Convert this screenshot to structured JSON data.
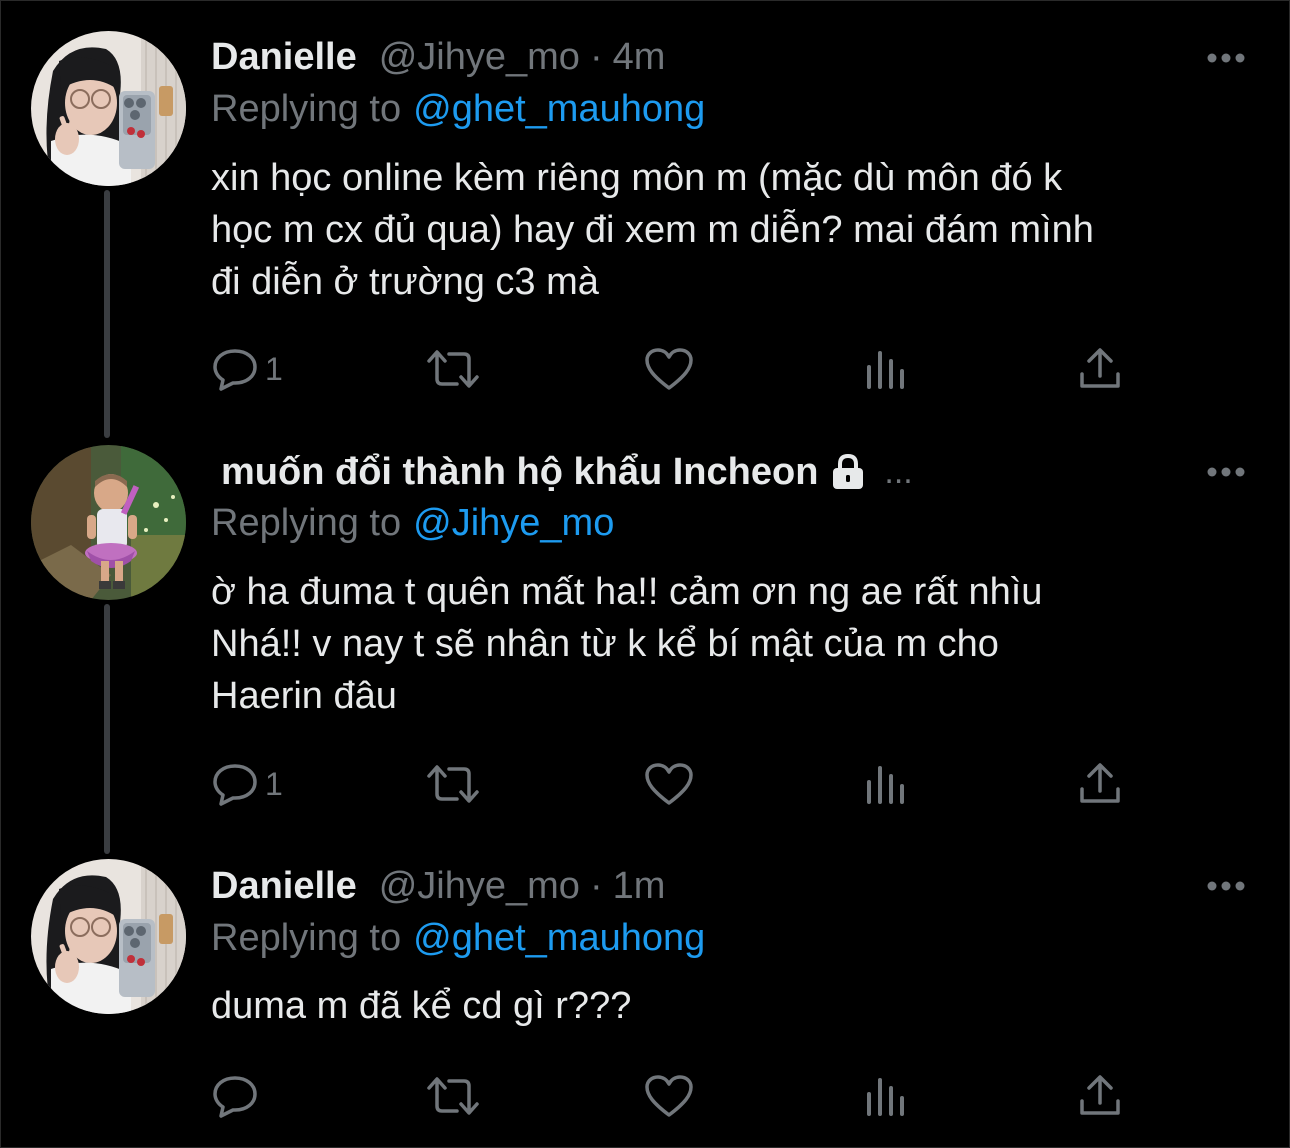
{
  "tweets": [
    {
      "display_name": "Danielle",
      "handle": "@Jihye_mo",
      "separator": "·",
      "time": "4m",
      "replying_prefix": "Replying to",
      "replying_to": "@ghet_mauhong",
      "body_lines": [
        "xin học online kèm riêng môn m (mặc dù môn đó k",
        "học m cx đủ qua) hay đi xem m diễn? mai đám mình",
        "đi diễn ở trường c3 mà"
      ],
      "reply_count": "1",
      "avatar": "girl-selfie-avatar"
    },
    {
      "display_name": "muốn đổi thành hộ khẩu Incheon",
      "trail": "...",
      "protected": true,
      "replying_prefix": "Replying to",
      "replying_to": "@Jihye_mo",
      "body_lines": [
        "ờ ha đuma t quên mất ha!! cảm ơn ng ae rất nhìu",
        "Nhá!! v nay t sẽ nhân từ k kể bí mật của m cho",
        "Haerin đâu"
      ],
      "reply_count": "1",
      "avatar": "game-character-avatar"
    },
    {
      "display_name": "Danielle",
      "handle": "@Jihye_mo",
      "separator": "·",
      "time": "1m",
      "replying_prefix": "Replying to",
      "replying_to": "@ghet_mauhong",
      "body_lines": [
        "duma m đã kể cd gì r???"
      ],
      "reply_count": "",
      "avatar": "girl-selfie-avatar"
    }
  ],
  "icons": {
    "reply": "reply-icon",
    "retweet": "retweet-icon",
    "like": "heart-icon",
    "views": "views-icon",
    "share": "share-icon",
    "more": "more-dots-icon",
    "lock": "lock-icon"
  },
  "colors": {
    "background": "#000000",
    "text": "#E7E9EA",
    "secondary": "#71767B",
    "link": "#1D9BF0",
    "thread_line": "#3a3d41"
  }
}
